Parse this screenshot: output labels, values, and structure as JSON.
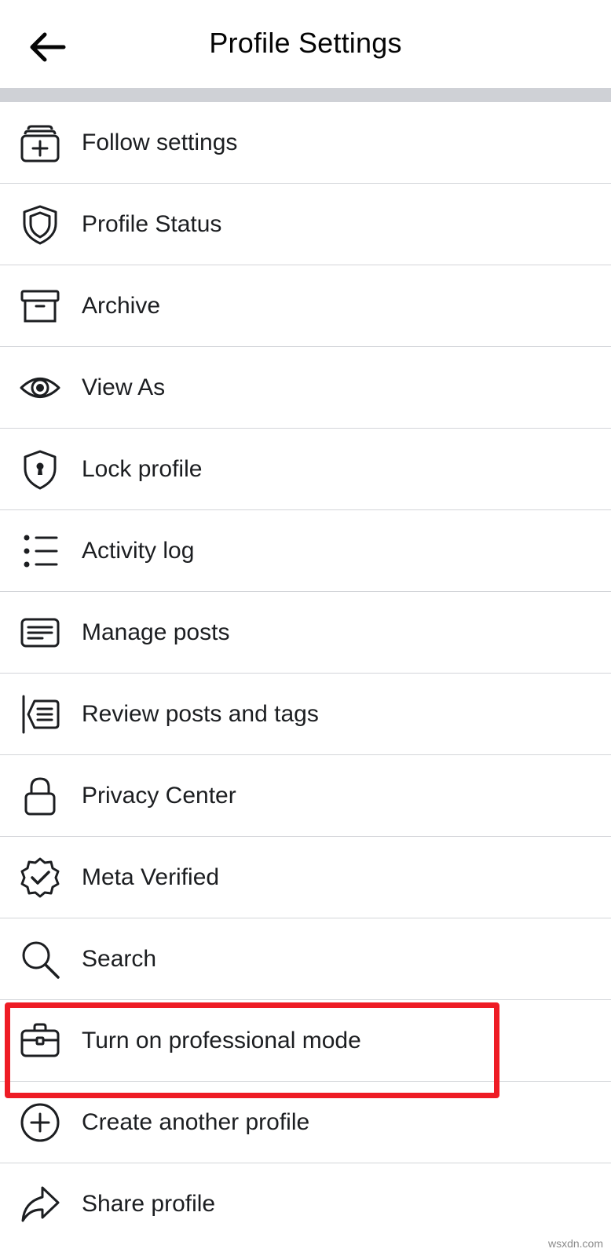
{
  "header": {
    "title": "Profile Settings",
    "back_icon": "arrow-left-icon"
  },
  "menu": {
    "items": [
      {
        "label": "Follow settings",
        "icon": "follow-settings-icon"
      },
      {
        "label": "Profile Status",
        "icon": "shield-icon"
      },
      {
        "label": "Archive",
        "icon": "archive-icon"
      },
      {
        "label": "View As",
        "icon": "eye-icon"
      },
      {
        "label": "Lock profile",
        "icon": "lock-shield-icon"
      },
      {
        "label": "Activity log",
        "icon": "list-icon"
      },
      {
        "label": "Manage posts",
        "icon": "posts-icon"
      },
      {
        "label": "Review posts and tags",
        "icon": "review-posts-icon"
      },
      {
        "label": "Privacy Center",
        "icon": "padlock-icon"
      },
      {
        "label": "Meta Verified",
        "icon": "verified-badge-icon"
      },
      {
        "label": "Search",
        "icon": "search-icon"
      },
      {
        "label": "Turn on professional mode",
        "icon": "briefcase-icon"
      },
      {
        "label": "Create another profile",
        "icon": "plus-circle-icon"
      },
      {
        "label": "Share profile",
        "icon": "share-icon"
      }
    ]
  },
  "annotation": {
    "highlight_color": "#ee1c25",
    "highlighted_item": "Turn on professional mode"
  },
  "watermark": {
    "text": "wsxdn.com"
  }
}
